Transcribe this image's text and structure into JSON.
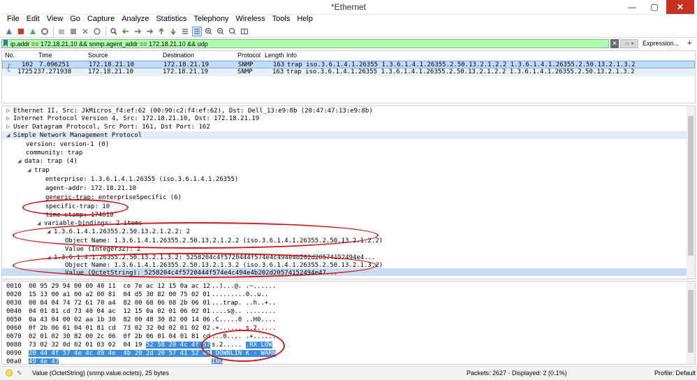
{
  "window": {
    "title": "*Ethernet",
    "min": "—",
    "max": "▢",
    "close": "✕"
  },
  "menu": [
    "File",
    "Edit",
    "View",
    "Go",
    "Capture",
    "Analyze",
    "Statistics",
    "Telephony",
    "Wireless",
    "Tools",
    "Help"
  ],
  "filter": {
    "value": "ip.addr == 172.18.21.10 && snmp.agent_addr == 172.18.21.10 && udp",
    "clear": "✕",
    "apply": "⇨ ▾",
    "expression": "Expression...",
    "plus": "+"
  },
  "packet_list": {
    "headers": {
      "no": "No.",
      "time": "Time",
      "source": "Source",
      "destination": "Destination",
      "protocol": "Protocol",
      "length": "Length",
      "info": "Info"
    },
    "rows": [
      {
        "no": "102",
        "time": "7.096251",
        "source": "172.18.21.10",
        "destination": "172.18.21.19",
        "protocol": "SNMP",
        "length": "163",
        "info": "trap iso.3.6.1.4.1.26355 1.3.6.1.4.1.26355.2.50.13.2.1.2.2 1.3.6.1.4.1.26355.2.50.13.2.1.3.2"
      },
      {
        "no": "1725",
        "time": "237.271938",
        "source": "172.18.21.10",
        "destination": "172.18.21.19",
        "protocol": "SNMP",
        "length": "163",
        "info": "trap iso.3.6.1.4.1.26355 1.3.6.1.4.1.26355.2.50.13.2.1.2.2 1.3.6.1.4.1.26355.2.50.13.2.1.3.2"
      }
    ]
  },
  "details": [
    {
      "text": "Ethernet II, Src: JkMicros_f4:ef:62 (00:90:c2:f4:ef:62), Dst: Dell_13:e9:8b (20:47:47:13:e9:8b)",
      "exp": "▷"
    },
    {
      "text": "Internet Protocol Version 4, Src: 172.18.21.10, Dst: 172.18.21.19",
      "exp": "▷"
    },
    {
      "text": "User Datagram Protocol, Src Port: 161, Dst Port: 162",
      "exp": "▷"
    },
    {
      "text": "Simple Network Management Protocol",
      "exp": "◢"
    },
    {
      "text": "version: version-1 (0)",
      "exp": ""
    },
    {
      "text": "community: trap",
      "exp": ""
    },
    {
      "text": "data: trap (4)",
      "exp": "◢"
    },
    {
      "text": "trap",
      "exp": "◢"
    },
    {
      "text": "enterprise: 1.3.6.1.4.1.26355 (iso.3.6.1.4.1.26355)",
      "exp": ""
    },
    {
      "text": "agent-addr: 172.18.21.10",
      "exp": ""
    },
    {
      "text": "generic-trap: enterpriseSpecific (6)",
      "exp": ""
    },
    {
      "text": "specific-trap: 10",
      "exp": ""
    },
    {
      "text": "time-stamp: 174610",
      "exp": ""
    },
    {
      "text": "variable-bindings: 2 items",
      "exp": "◢"
    },
    {
      "text": "1.3.6.1.4.1.26355.2.50.13.2.1.2.2: 2",
      "exp": "◢"
    },
    {
      "text": "Object Name: 1.3.6.1.4.1.26355.2.50.13.2.1.2.2 (iso.3.6.1.4.1.26355.2.50.13.2.1.2.2)",
      "exp": ""
    },
    {
      "text": "Value (Integer32): 2",
      "exp": ""
    },
    {
      "text": "1.3.6.1.4.1.26355.2.50.13.2.1.3.2: 5258204c4f5720444f574e4c494e4b202d20574152494e4...",
      "exp": "◢"
    },
    {
      "text": "Object Name: 1.3.6.1.4.1.26355.2.50.13.2.1.3.2 (iso.3.6.1.4.1.26355.2.50.13.2.1.3.2)",
      "exp": ""
    },
    {
      "text": "Value (OctetString): 5258204c4f5720444f574e4c494e4b202d20574152494e47...",
      "exp": ""
    }
  ],
  "hex": [
    {
      "off": "0010",
      "bytes": "00 95 29 94 00 00 40 11  ce 7e ac 12 15 0a ac 12",
      "ascii": "..)...@. .~......",
      "hl": ""
    },
    {
      "off": "0020",
      "bytes": "15 13 00 a1 00 a2 00 81  04 d5 30 82 00 75 02 01",
      "ascii": ".........0..u..",
      "hl": ""
    },
    {
      "off": "0030",
      "bytes": "00 04 04 74 72 61 70 a4  82 00 68 06 08 2b 06 01",
      "ascii": "...trap. ..h..+..",
      "hl": ""
    },
    {
      "off": "0040",
      "bytes": "04 01 81 cd 73 40 04 ac  12 15 0a 02 01 06 02 01",
      "ascii": "....s@.. ........",
      "hl": ""
    },
    {
      "off": "0050",
      "bytes": "0a 43 04 00 02 aa 1b 30  82 00 48 30 82 00 14 06",
      "ascii": ".C.....0 ..H0....",
      "hl": ""
    },
    {
      "off": "0060",
      "bytes": "0f 2b 06 01 04 01 81 cd  73 02 32 0d 02 01 02 02",
      "ascii": ".+...... s.2.....",
      "hl": ""
    },
    {
      "off": "0070",
      "bytes": "02 01 02 30 82 00 2c 06  0f 2b 06 01 04 01 81 cd",
      "ascii": "...0..,. .+......",
      "hl": ""
    },
    {
      "off": "0080",
      "bytes": "73 02 32 0d 02 01 03 02  04 19 ",
      "ascii": "s.2..... ",
      "hl": "52 58 20 4c 4f 57",
      "hlascii": ".RX LOW"
    },
    {
      "off": "0090",
      "bytes": "",
      "ascii": "",
      "hl": "20 44 4f 57 4e 4c 49 4e  4b 20 2d 20 57 41 52 4e",
      "hlascii": " DOWNLIN K - WARN"
    },
    {
      "off": "00a0",
      "bytes": "",
      "ascii": "",
      "hl": "49 4e 47",
      "hlascii": "ING"
    }
  ],
  "status": {
    "field": "Value (OctetString) (snmp.value.octets), 25 bytes",
    "packets": "Packets: 2627 · Displayed: 2 (0.1%)",
    "profile": "Profile: Default"
  },
  "colors": {
    "filter_ok": "#afffaf",
    "selected_row": "#c3dcf5",
    "hex_highlight": "#3a8de0",
    "annotation": "#d01818"
  }
}
